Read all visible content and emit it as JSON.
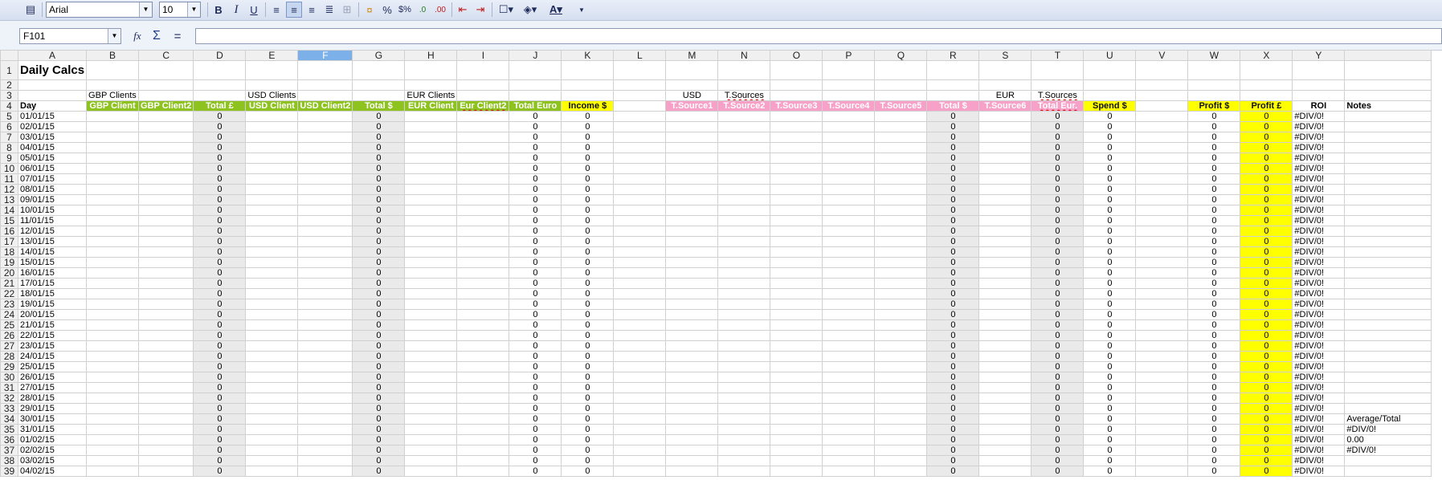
{
  "toolbar": {
    "font_name": "Arial",
    "font_size": "10"
  },
  "formula": {
    "cell_ref": "F101",
    "content": ""
  },
  "columns": [
    "A",
    "B",
    "C",
    "D",
    "E",
    "F",
    "G",
    "H",
    "I",
    "J",
    "K",
    "L",
    "M",
    "N",
    "O",
    "P",
    "Q",
    "R",
    "S",
    "T",
    "U",
    "V",
    "W",
    "X",
    "Y",
    ""
  ],
  "selected_column": "F",
  "row1": {
    "title": "Daily Calcs"
  },
  "row3": {
    "gbp": "GBP Clients",
    "usd": "USD Clients",
    "eur": "EUR Clients",
    "usd2": "USD",
    "tsources1": "T.Sources",
    "eur2": "EUR",
    "tsources2": "T.Sources"
  },
  "row4": [
    "Day",
    "GBP Client",
    "GBP Client2",
    "Total £",
    "USD Client",
    "USD Client2",
    "Total $",
    "EUR Client",
    "Eur Client2",
    "Total Euro",
    "Income $",
    "",
    "T.Source1",
    "T.Source2",
    "T.Source3",
    "T.Source4",
    "T.Source5",
    "Total $",
    "T.Source6",
    "Total Eur.",
    "Spend $",
    "",
    "Profit $",
    "Profit £",
    "ROI",
    "Notes"
  ],
  "dates": [
    "01/01/15",
    "02/01/15",
    "03/01/15",
    "04/01/15",
    "05/01/15",
    "06/01/15",
    "07/01/15",
    "08/01/15",
    "09/01/15",
    "10/01/15",
    "11/01/15",
    "12/01/15",
    "13/01/15",
    "14/01/15",
    "15/01/15",
    "16/01/15",
    "17/01/15",
    "18/01/15",
    "19/01/15",
    "20/01/15",
    "21/01/15",
    "22/01/15",
    "23/01/15",
    "24/01/15",
    "25/01/15",
    "26/01/15",
    "27/01/15",
    "28/01/15",
    "29/01/15",
    "30/01/15",
    "31/01/15",
    "01/02/15",
    "02/02/15",
    "03/02/15",
    "04/02/15"
  ],
  "zero": "0",
  "roi": "#DIV/0!",
  "notes": {
    "34": "Average/Total",
    "35": "#DIV/0!",
    "36": "0.00",
    "37": "#DIV/0!"
  }
}
